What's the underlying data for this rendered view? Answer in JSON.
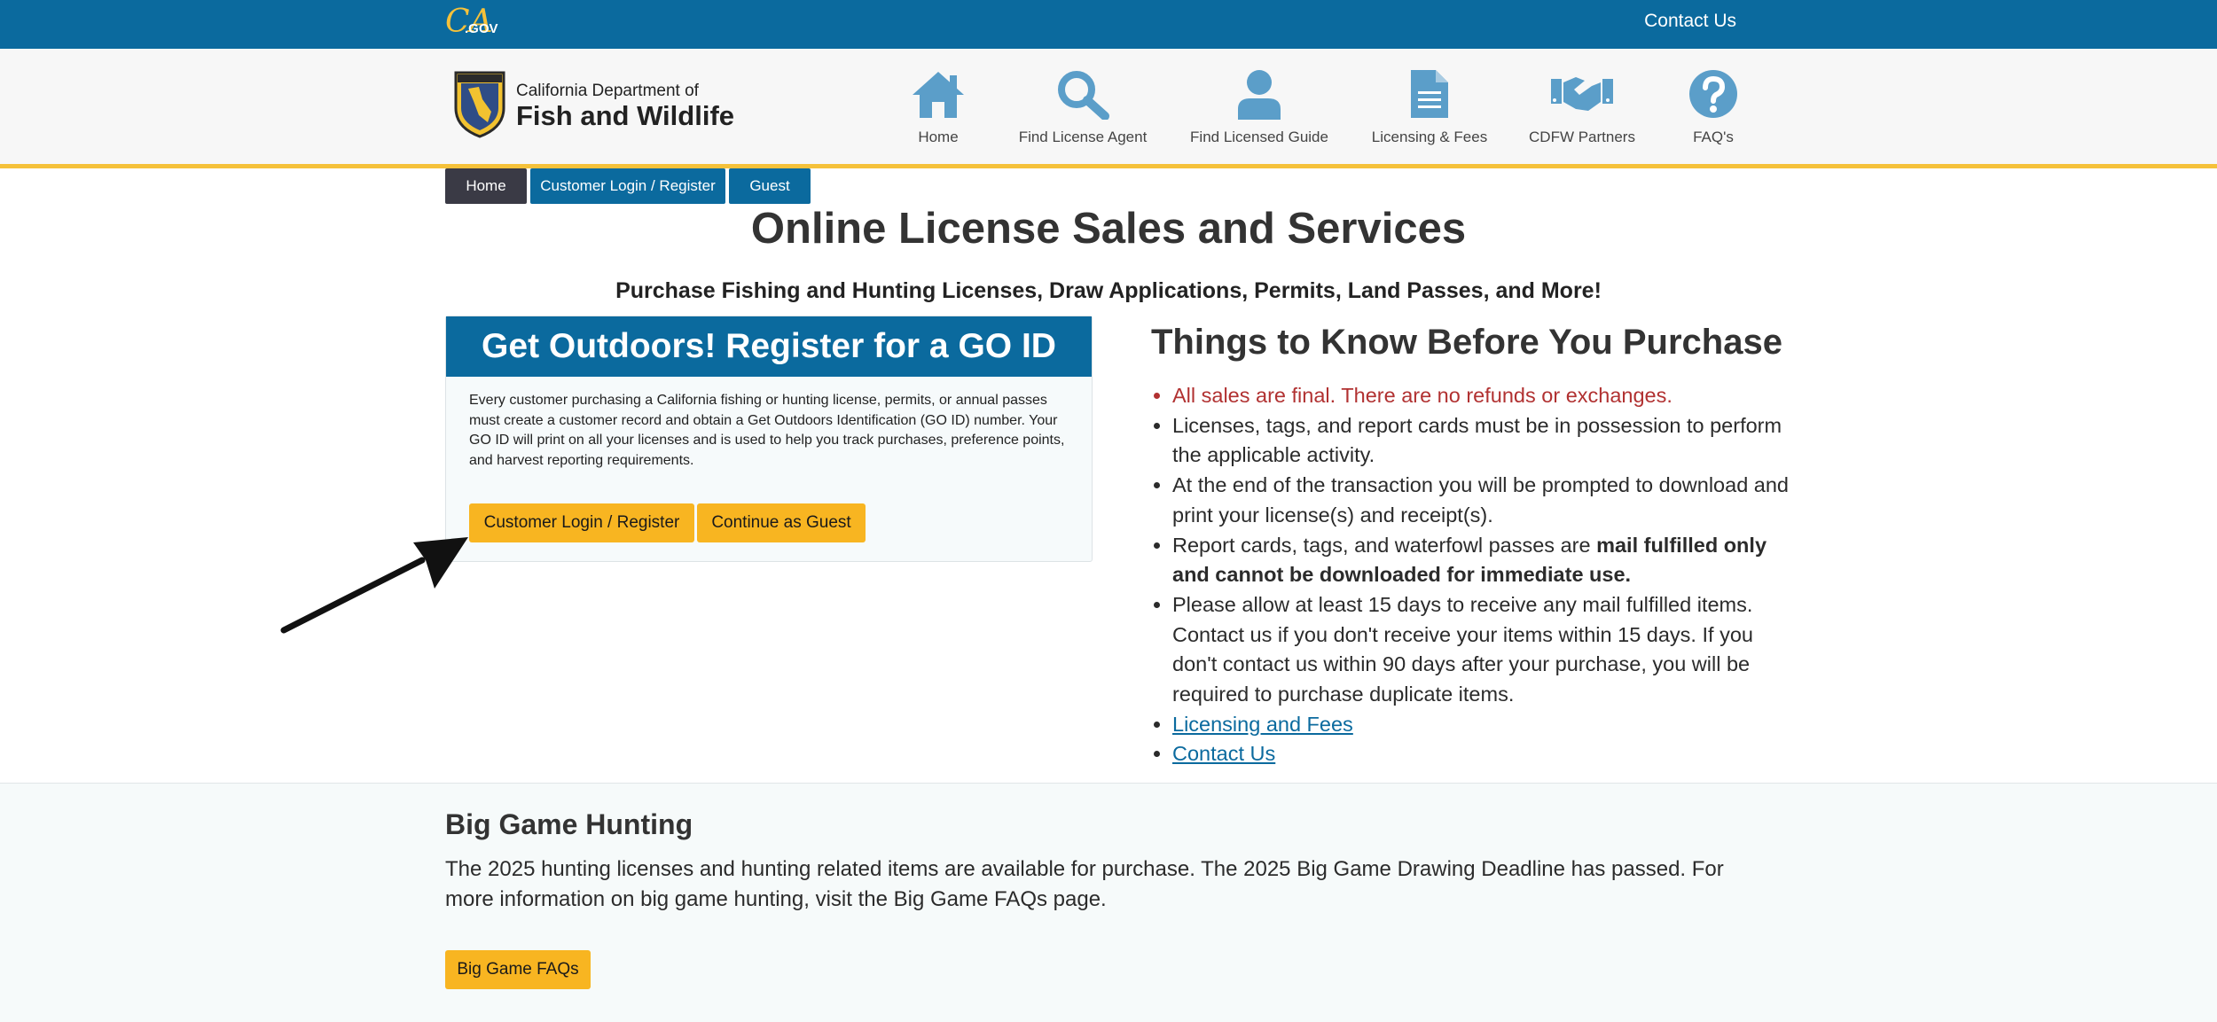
{
  "topbar": {
    "logo_main": "CA",
    "logo_sub": ".GOV",
    "contact_label": "Contact Us"
  },
  "header": {
    "logo_line1": "California Department of",
    "logo_line2": "Fish and Wildlife",
    "nav": [
      {
        "label": "Home",
        "icon": "home-icon"
      },
      {
        "label": "Find License Agent",
        "icon": "search-icon"
      },
      {
        "label": "Find Licensed Guide",
        "icon": "person-icon"
      },
      {
        "label": "Licensing & Fees",
        "icon": "document-icon"
      },
      {
        "label": "CDFW Partners",
        "icon": "handshake-icon"
      },
      {
        "label": "FAQ's",
        "icon": "question-icon"
      }
    ]
  },
  "breadcrumb": [
    {
      "label": "Home",
      "color": "#3a3a45"
    },
    {
      "label": "Customer Login / Register",
      "color": "#0b6a9e"
    },
    {
      "label": "Guest",
      "color": "#0b6a9e"
    }
  ],
  "main": {
    "title": "Online License Sales and Services",
    "subtitle": "Purchase Fishing and Hunting Licenses, Draw Applications, Permits, Land Passes, and More!"
  },
  "register_panel": {
    "heading": "Get Outdoors! Register for a GO ID",
    "text": "Every customer purchasing a California fishing or hunting license, permits, or annual passes must create a customer record and obtain a Get Outdoors Identification (GO ID) number. Your GO ID will print on all your licenses and is used to help you track purchases, preference points, and harvest reporting requirements.",
    "login_button": "Customer Login / Register",
    "guest_button": "Continue as Guest"
  },
  "things_to_know": {
    "title": "Things to Know Before You Purchase",
    "item1": "All sales are final. There are no refunds or exchanges.",
    "item2": "Licenses, tags, and report cards must be in possession to perform the applicable activity.",
    "item3": "At the end of the transaction you will be prompted to download and print your license(s) and receipt(s).",
    "item4_prefix": "Report cards, tags, and waterfowl passes are ",
    "item4_bold": "mail fulfilled only and cannot be downloaded for immediate use.",
    "item5": "Please allow at least 15 days to receive any mail fulfilled items. Contact us if you don't receive your items within 15 days. If you don't contact us within 90 days after your purchase, you will be required to purchase duplicate items.",
    "link_fees": "Licensing and Fees",
    "link_contact": "Contact Us"
  },
  "big_game": {
    "title": "Big Game Hunting",
    "text": "The 2025 hunting licenses and hunting related items are available for purchase. The 2025 Big Game Drawing Deadline has passed. For more information on big game hunting, visit the Big Game FAQs page.",
    "button": "Big Game FAQs"
  },
  "colors": {
    "brand_blue": "#0b6a9e",
    "accent_gold": "#f5c13a",
    "button_gold": "#f8b521",
    "icon_blue": "#5b9ec9",
    "alert_red": "#b13131"
  }
}
